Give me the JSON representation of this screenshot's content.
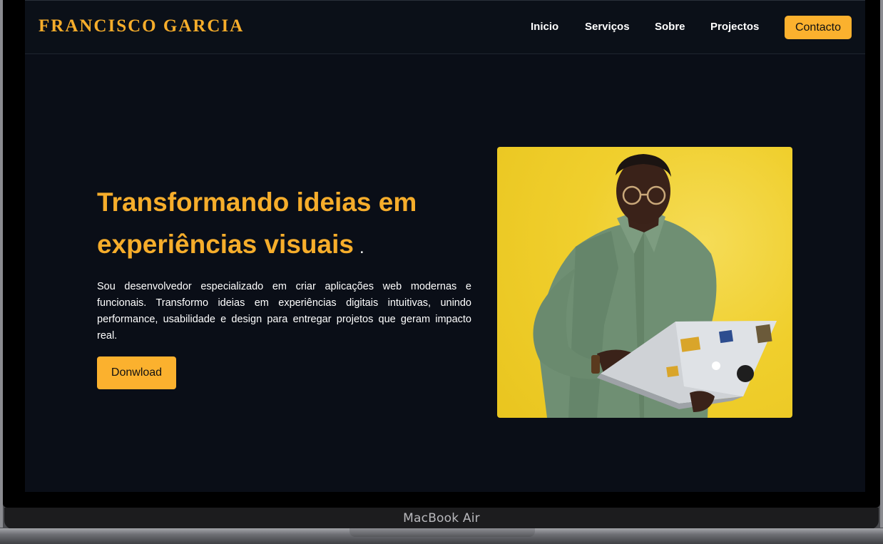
{
  "header": {
    "brand": "FRANCISCO GARCIA",
    "nav": [
      "Inicio",
      "Serviços",
      "Sobre",
      "Projectos"
    ],
    "contact_label": "Contacto"
  },
  "hero": {
    "title": "Transformando ideias em experiências visuais",
    "title_suffix": ".",
    "description": "Sou desenvolvedor especializado em criar aplicações web modernas e funcionais. Transformo ideias em experiências digitais intuitivas, unindo performance, usabilidade e design para entregar projetos que geram impacto real.",
    "download_label": "Donwload"
  },
  "device": {
    "label": "MacBook Air"
  },
  "colors": {
    "accent": "#fbb12e",
    "background": "#0a0e17",
    "photo_background": "#f0cf2d"
  }
}
